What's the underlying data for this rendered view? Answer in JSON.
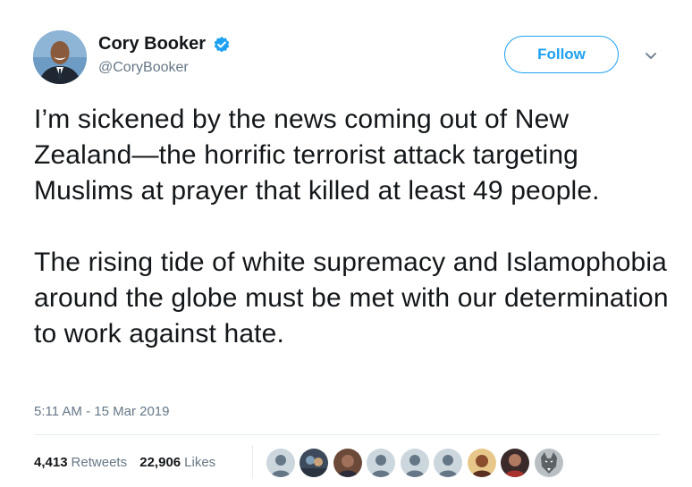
{
  "tweet": {
    "author": {
      "display_name": "Cory Booker",
      "handle": "@CoryBooker",
      "verified_icon": "verified-badge-icon",
      "avatar_icon": "profile-avatar"
    },
    "follow_label": "Follow",
    "caret_icon": "chevron-down-icon",
    "text": {
      "paragraph1": "I’m sickened by the news coming out of New Zealand—the horrific terrorist attack targeting Muslims at prayer that killed at least 49 people.",
      "paragraph2": "The rising tide of white supremacy and Islamophobia around the globe must be met with our determination to work against hate."
    },
    "timestamp": "5:11 AM - 15 Mar 2019",
    "stats": {
      "retweets_count": "4,413",
      "retweets_label": "Retweets",
      "likes_count": "22,906",
      "likes_label": "Likes"
    },
    "likers": [
      "default",
      "photo",
      "photo",
      "default",
      "default",
      "default",
      "photo",
      "photo",
      "photo"
    ]
  },
  "colors": {
    "accent": "#1da1f2",
    "text": "#14171a",
    "secondary": "#657786",
    "divider": "#e6ecf0"
  }
}
